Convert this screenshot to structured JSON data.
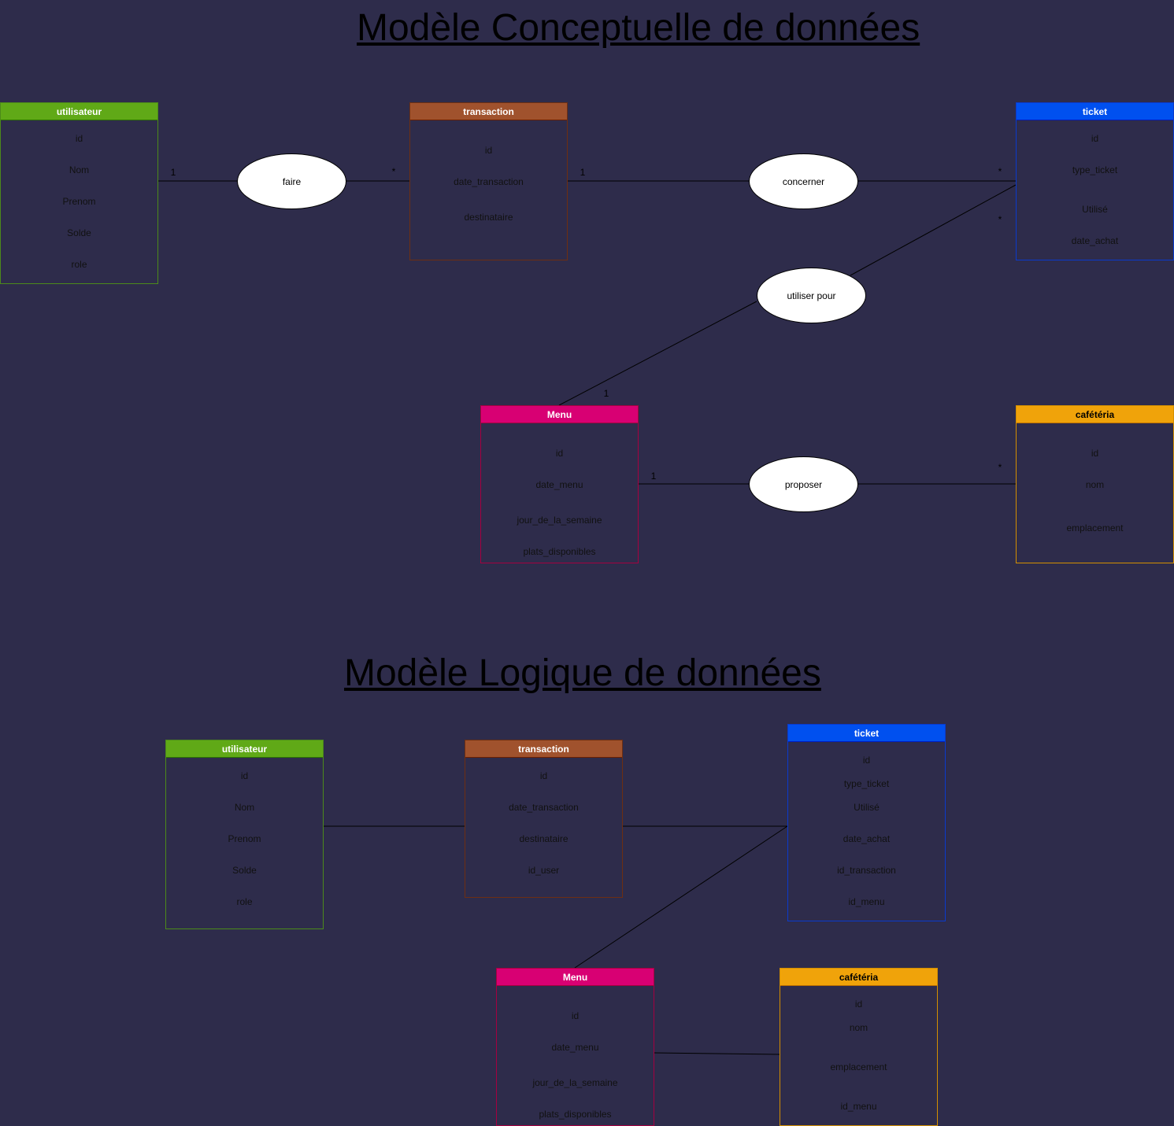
{
  "mcd": {
    "title": "Modèle Conceptuelle de données",
    "entities": {
      "utilisateur": {
        "name": "utilisateur",
        "fields": [
          "id",
          "Nom",
          "Prenom",
          "Solde",
          "role"
        ]
      },
      "transaction": {
        "name": "transaction",
        "fields": [
          "id",
          "date_transaction",
          "destinataire"
        ]
      },
      "ticket": {
        "name": "ticket",
        "fields": [
          "id",
          "type_ticket",
          "Utilisé",
          "date_achat"
        ]
      },
      "menu": {
        "name": "Menu",
        "fields": [
          "id",
          "date_menu",
          "jour_de_la_semaine",
          "plats_disponibles"
        ]
      },
      "cafeteria": {
        "name": "cafétéria",
        "fields": [
          "id",
          "nom",
          "emplacement"
        ]
      }
    },
    "associations": {
      "faire": "faire",
      "concerner": "concerner",
      "utiliser_pour": "utiliser pour",
      "proposer": "proposer"
    },
    "cardinalities": {
      "faire_left": "1",
      "faire_right": "*",
      "concerner_left": "1",
      "concerner_right": "*",
      "utiliser_ticket": "*",
      "utiliser_menu": "1",
      "proposer_left": "1",
      "proposer_right": "*"
    }
  },
  "mld": {
    "title": "Modèle Logique de données",
    "entities": {
      "utilisateur": {
        "name": "utilisateur",
        "fields": [
          "id",
          "Nom",
          "Prenom",
          "Solde",
          "role"
        ]
      },
      "transaction": {
        "name": "transaction",
        "fields": [
          "id",
          "date_transaction",
          "destinataire",
          "id_user"
        ]
      },
      "ticket": {
        "name": "ticket",
        "fields": [
          "id",
          "type_ticket",
          "Utilisé",
          "date_achat",
          "id_transaction",
          "id_menu"
        ]
      },
      "menu": {
        "name": "Menu",
        "fields": [
          "id",
          "date_menu",
          "jour_de_la_semaine",
          "plats_disponibles"
        ]
      },
      "cafeteria": {
        "name": "cafétéria",
        "fields": [
          "id",
          "nom",
          "emplacement",
          "id_menu"
        ]
      }
    }
  }
}
